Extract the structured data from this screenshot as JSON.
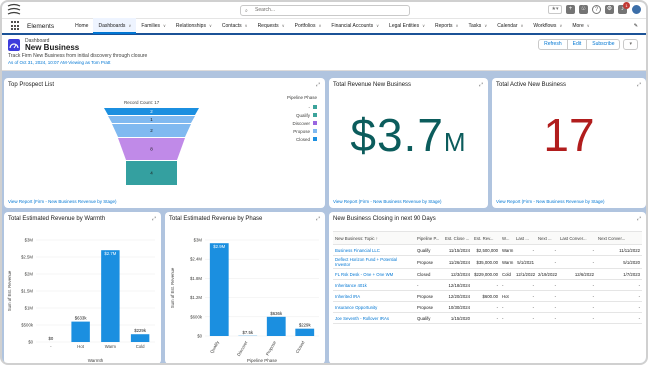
{
  "topbar": {
    "search_placeholder": "Search...",
    "notification_count": "1"
  },
  "nav": {
    "app_name": "Elements",
    "items": [
      {
        "label": "Home",
        "chevron": false,
        "active": false
      },
      {
        "label": "Dashboards",
        "chevron": true,
        "active": true
      },
      {
        "label": "Families",
        "chevron": true,
        "active": false
      },
      {
        "label": "Relationships",
        "chevron": true,
        "active": false
      },
      {
        "label": "Contacts",
        "chevron": true,
        "active": false
      },
      {
        "label": "Requests",
        "chevron": true,
        "active": false
      },
      {
        "label": "Portfolios",
        "chevron": true,
        "active": false
      },
      {
        "label": "Financial Accounts",
        "chevron": true,
        "active": false
      },
      {
        "label": "Legal Entities",
        "chevron": true,
        "active": false
      },
      {
        "label": "Reports",
        "chevron": true,
        "active": false
      },
      {
        "label": "Tasks",
        "chevron": true,
        "active": false
      },
      {
        "label": "Calendar",
        "chevron": true,
        "active": false
      },
      {
        "label": "Workflows",
        "chevron": true,
        "active": false
      },
      {
        "label": "More",
        "chevron": true,
        "active": false
      }
    ]
  },
  "header": {
    "breadcrumb": "Dashboard",
    "title": "New Business",
    "description": "Track Firm New Business from initial discovery through closure",
    "as_of": "As of Oct 31, 2024, 10:07 AM·Viewing as Tom Pratt",
    "buttons": {
      "refresh": "Refresh",
      "edit": "Edit",
      "subscribe": "Subscribe"
    }
  },
  "widgets": {
    "funnel": {
      "title": "Top Prospect List",
      "record_count": "Record Count: 17",
      "view_report": "View Report (Firm - New Business Revenue by Stage)",
      "legend_title": "Pipeline Phase",
      "legend": [
        {
          "label": "-",
          "color": "#3ba39b"
        },
        {
          "label": "Qualify",
          "color": "#3ba39b"
        },
        {
          "label": "Discover",
          "color": "#9966e0"
        },
        {
          "label": "Propose",
          "color": "#80b9f0"
        },
        {
          "label": "Closed",
          "color": "#1b8fe0"
        }
      ],
      "stages": [
        {
          "label": "2",
          "color": "#1b8fe0"
        },
        {
          "label": "1",
          "color": "#80b9f0"
        },
        {
          "label": "2",
          "color": "#80b9f0"
        },
        {
          "label": "8",
          "color": "#c08ae8"
        },
        {
          "label": "4",
          "color": "#34a0a0"
        }
      ]
    },
    "revenue": {
      "title": "Total Revenue New Business",
      "value": "$3.7",
      "suffix": "M",
      "view_report": "View Report (Firm - New Business Revenue by Stage)"
    },
    "active": {
      "title": "Total Active New Business",
      "value": "17",
      "view_report": "View Report (Firm - New Business Revenue by Stage)"
    },
    "warmth": {
      "title": "Total Estimated Revenue by Warmth"
    },
    "phase": {
      "title": "Total Estimated Revenue by Phase"
    },
    "closing": {
      "title": "New Business Closing in next 90 Days",
      "columns": [
        "New Business: Topic ↑",
        "Pipeline P...",
        "Est. Close ...",
        "Est. Rev...",
        "W...",
        "Last ...",
        "Next ...",
        "Last Conver...",
        "Next Conver..."
      ],
      "rows": [
        [
          "Business Financial LLC",
          "Qualify",
          "11/15/2024",
          "$2,500,000",
          "Warm",
          "-",
          "-",
          "-",
          "11/11/2022"
        ],
        [
          "Deflect Horizon Fund + Potential Investor",
          "Propose",
          "11/26/2024",
          "$35,000.00",
          "Warm",
          "5/1/2021",
          "-",
          "-",
          "5/1/2020"
        ],
        [
          "FL Rsk Desk - One + One WM",
          "Closed",
          "12/3/2024",
          "$229,000.00",
          "Cold",
          "12/1/2022",
          "2/19/2022",
          "12/6/2022",
          "1/7/2023"
        ],
        [
          "Inheritance 401k",
          "-",
          "12/18/2024",
          "-",
          "-",
          "-",
          "-",
          "-",
          "-"
        ],
        [
          "Inherited IRA",
          "Propose",
          "12/20/2024",
          "$600.00",
          "Hot",
          "-",
          "-",
          "-",
          "-"
        ],
        [
          "Insurance Opportunity",
          "Propose",
          "10/30/2024",
          "-",
          "-",
          "-",
          "-",
          "-",
          "-"
        ],
        [
          "Joe Seventh - Rollover IRAs",
          "Qualify",
          "1/15/2020",
          "-",
          "-",
          "-",
          "-",
          "-",
          "-"
        ]
      ]
    }
  },
  "chart_data": [
    {
      "type": "bar",
      "title": "Total Estimated Revenue by Warmth",
      "xlabel": "Warmth",
      "ylabel": "Sum of Est. Revenue",
      "categories": [
        "-",
        "Hot",
        "Warm",
        "Cold"
      ],
      "values": [
        0,
        600000,
        2700000,
        229000
      ],
      "data_labels": [
        "$0",
        "$633k",
        "$2.7M",
        "$229k"
      ],
      "yticks": [
        "$0",
        "$500k",
        "$1M",
        "$1.5M",
        "$2M",
        "$2.5M",
        "$3M"
      ],
      "ylim": [
        0,
        3000000
      ],
      "color": "#1b8fe0"
    },
    {
      "type": "bar",
      "title": "Total Estimated Revenue by Phase",
      "xlabel": "Pipeline Phase",
      "ylabel": "Sum of Est. Revenue",
      "categories": [
        "Qualify",
        "Discover",
        "Propose",
        "Closed"
      ],
      "values": [
        2900000,
        7500,
        600000,
        229000
      ],
      "data_labels": [
        "$2.9M",
        "$7.5k",
        "$636k",
        "$229k"
      ],
      "yticks": [
        "$0",
        "$600k",
        "$1.2M",
        "$1.8M",
        "$2.4M",
        "$3M"
      ],
      "ylim": [
        0,
        3000000
      ],
      "color": "#1b8fe0"
    }
  ]
}
